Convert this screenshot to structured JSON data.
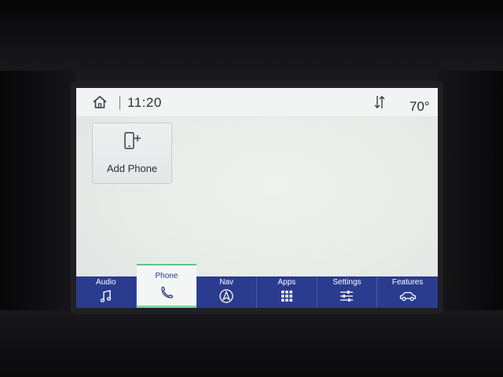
{
  "status_bar": {
    "time": "11:20",
    "temperature": "70°",
    "home_icon": "home-icon",
    "data_icon": "data-transfer-icon"
  },
  "main": {
    "add_phone": {
      "label": "Add Phone",
      "icon": "add-phone-icon"
    }
  },
  "nav": {
    "active_tab": "Phone",
    "tabs": [
      {
        "label": "Audio",
        "icon": "music-note-icon"
      },
      {
        "label": "Phone",
        "icon": "phone-handset-icon"
      },
      {
        "label": "Nav",
        "icon": "navigation-arrow-icon"
      },
      {
        "label": "Apps",
        "icon": "apps-grid-icon"
      },
      {
        "label": "Settings",
        "icon": "sliders-icon"
      },
      {
        "label": "Features",
        "icon": "car-icon"
      }
    ]
  },
  "colors": {
    "nav_bar": "#2a3c8e",
    "screen_background": "#e9ede9",
    "active_tab_background": "#f4f6f5",
    "active_indicator": "#7fd3a3"
  }
}
